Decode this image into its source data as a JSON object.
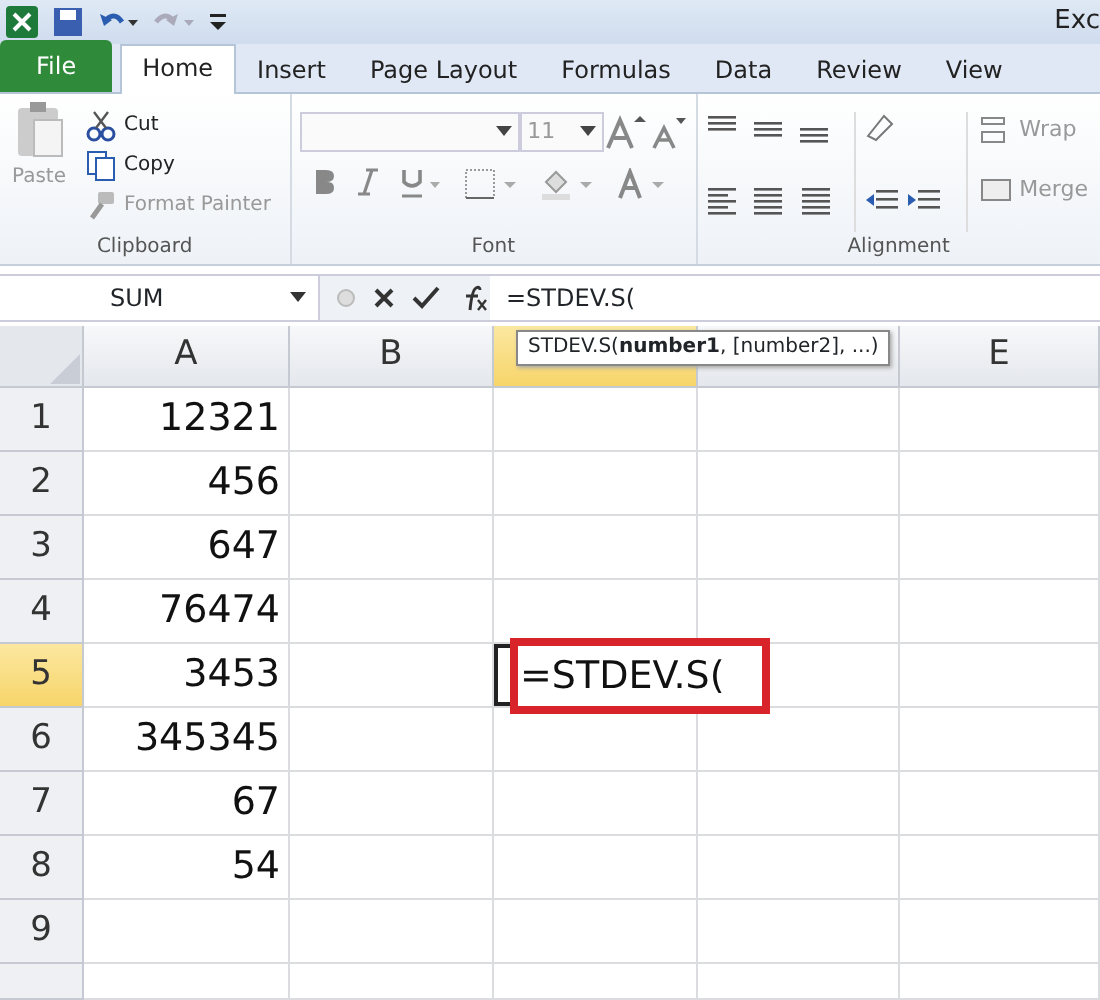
{
  "window": {
    "title": "Exc"
  },
  "tabs": [
    {
      "label": "File",
      "kind": "file",
      "selected": false
    },
    {
      "label": "Home",
      "kind": "tab",
      "selected": true
    },
    {
      "label": "Insert",
      "kind": "tab",
      "selected": false
    },
    {
      "label": "Page Layout",
      "kind": "tab",
      "selected": false
    },
    {
      "label": "Formulas",
      "kind": "tab",
      "selected": false
    },
    {
      "label": "Data",
      "kind": "tab",
      "selected": false
    },
    {
      "label": "Review",
      "kind": "tab",
      "selected": false
    },
    {
      "label": "View",
      "kind": "tab",
      "selected": false
    }
  ],
  "ribbon": {
    "clipboard": {
      "label": "Clipboard",
      "paste": {
        "label": "Paste",
        "disabled": true
      },
      "cut": {
        "label": "Cut",
        "disabled": false
      },
      "copy": {
        "label": "Copy",
        "disabled": false
      },
      "format_painter": {
        "label": "Format Painter",
        "disabled": true
      }
    },
    "font": {
      "label": "Font",
      "font_size": "11"
    },
    "alignment": {
      "label": "Alignment",
      "wrap": "Wrap",
      "merge": "Merge"
    }
  },
  "formula_bar": {
    "name_box": "SUM",
    "formula": "=STDEV.S("
  },
  "tooltip": "STDEV.S(**number1**, [number2], ...)",
  "columns": [
    {
      "label": "A",
      "selected": false
    },
    {
      "label": "B",
      "selected": false
    },
    {
      "selected": true
    },
    {
      "selected": false
    },
    {
      "label": "E",
      "selected": false
    }
  ],
  "rows": [
    {
      "label": "1",
      "selected": false,
      "cells": [
        "12321",
        "",
        "",
        "",
        ""
      ]
    },
    {
      "label": "2",
      "selected": false,
      "cells": [
        "456",
        "",
        "",
        "",
        ""
      ]
    },
    {
      "label": "3",
      "selected": false,
      "cells": [
        "647",
        "",
        "",
        "",
        ""
      ]
    },
    {
      "label": "4",
      "selected": false,
      "cells": [
        "76474",
        "",
        "",
        "",
        ""
      ]
    },
    {
      "label": "5",
      "selected": true,
      "cells": [
        "3453",
        "",
        "=STDEV.S(",
        "",
        ""
      ]
    },
    {
      "label": "6",
      "selected": false,
      "cells": [
        "345345",
        "",
        "",
        "",
        ""
      ]
    },
    {
      "label": "7",
      "selected": false,
      "cells": [
        "67",
        "",
        "",
        "",
        ""
      ]
    },
    {
      "label": "8",
      "selected": false,
      "cells": [
        "54",
        "",
        "",
        "",
        ""
      ]
    },
    {
      "label": "9",
      "selected": false,
      "cells": [
        "",
        "",
        "",
        "",
        ""
      ]
    },
    {
      "selected": false,
      "cells": [
        "",
        "",
        "",
        "",
        ""
      ]
    }
  ]
}
